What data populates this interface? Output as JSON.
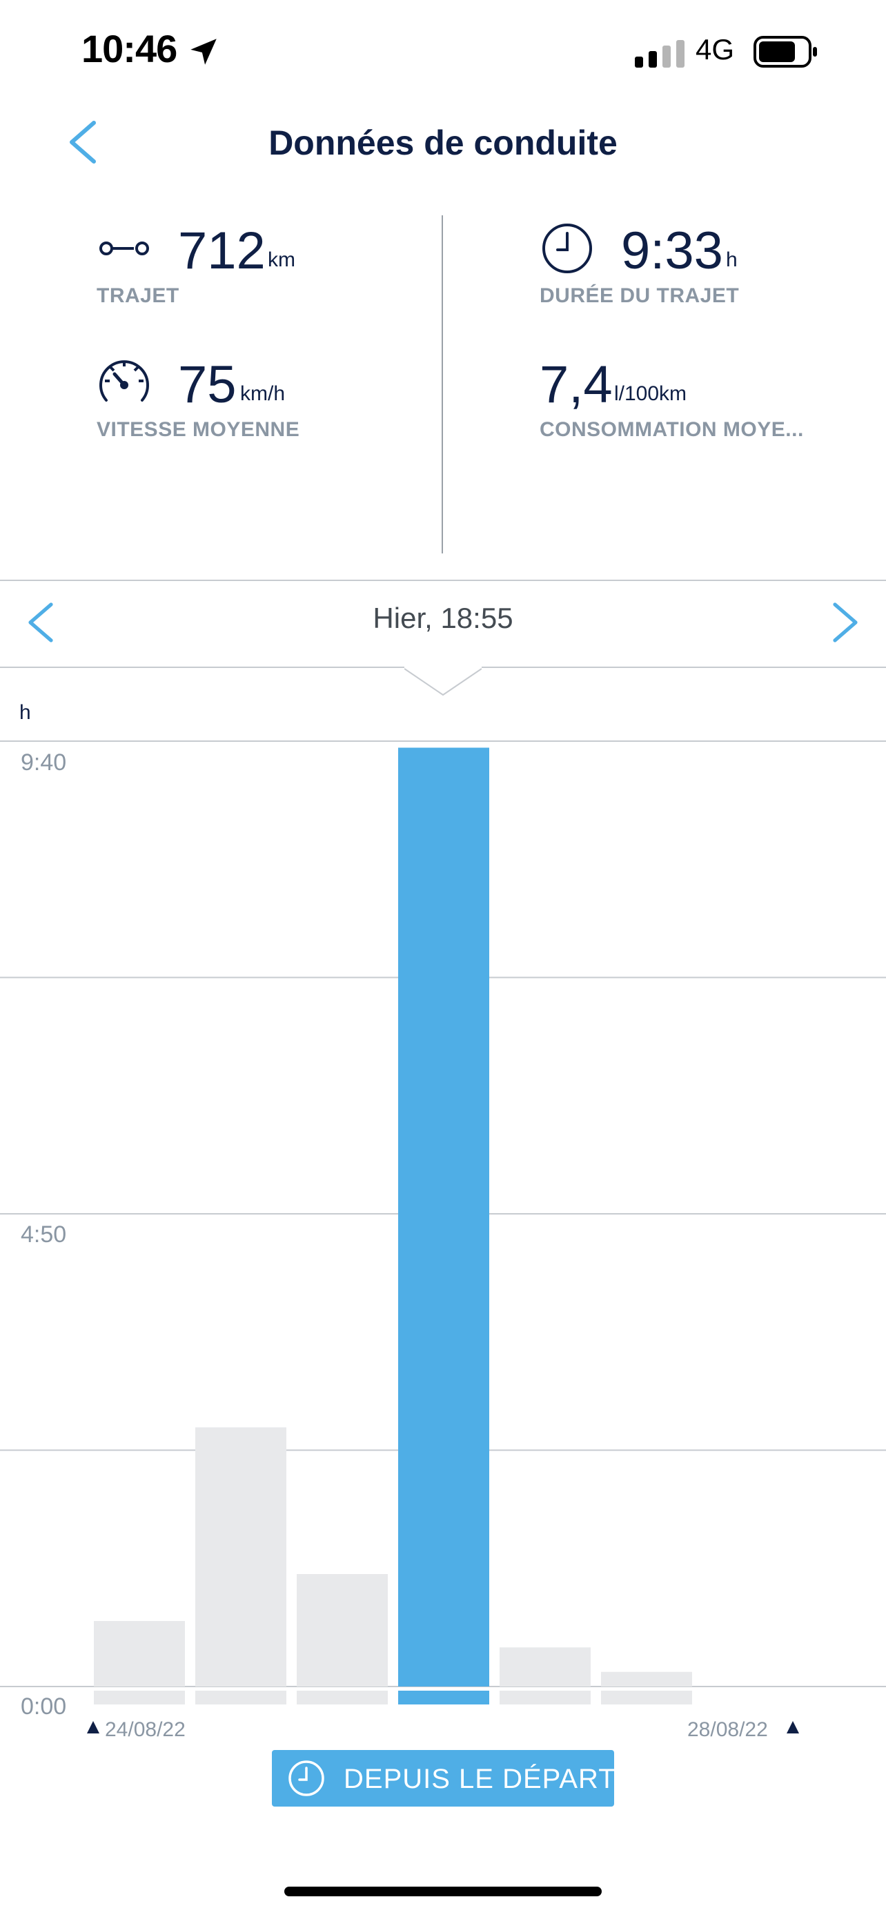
{
  "status_bar": {
    "time": "10:46",
    "network": "4G"
  },
  "header": {
    "title": "Données de conduite"
  },
  "stats": {
    "trajet": {
      "value": "712",
      "unit": "km",
      "label": "TRAJET",
      "icon": "route-icon"
    },
    "duree": {
      "value": "9:33",
      "unit": "h",
      "label": "DURÉE DU TRAJET",
      "icon": "clock-icon"
    },
    "vitesse": {
      "value": "75",
      "unit": "km/h",
      "label": "VITESSE MOYENNE",
      "icon": "speedometer-icon"
    },
    "consommation": {
      "value": "7,4",
      "unit": "l/100km",
      "label": "CONSOMMATION MOYE...",
      "icon": "fuel-icon"
    }
  },
  "period_nav": {
    "label": "Hier, 18:55"
  },
  "chart": {
    "unit": "h",
    "y_labels": [
      "9:40",
      "4:50",
      "0:00"
    ],
    "start_date": "24/08/22",
    "end_date": "28/08/22"
  },
  "chart_data": {
    "type": "bar",
    "categories": [
      "1",
      "2",
      "3",
      "4",
      "5",
      "6"
    ],
    "values": [
      0.67,
      2.65,
      1.15,
      9.6,
      0.4,
      0.15
    ],
    "selected_index": 3,
    "ylabel": "h",
    "ylim": [
      0,
      9.667
    ],
    "grid": true,
    "colors": {
      "selected": "#4faee6",
      "unselected": "#e8e9eb"
    }
  },
  "since_button": {
    "label": "DEPUIS LE DÉPART"
  },
  "colors": {
    "accent": "#4faee6",
    "text_dark": "#0f1f45",
    "text_muted": "#8a96a3"
  }
}
